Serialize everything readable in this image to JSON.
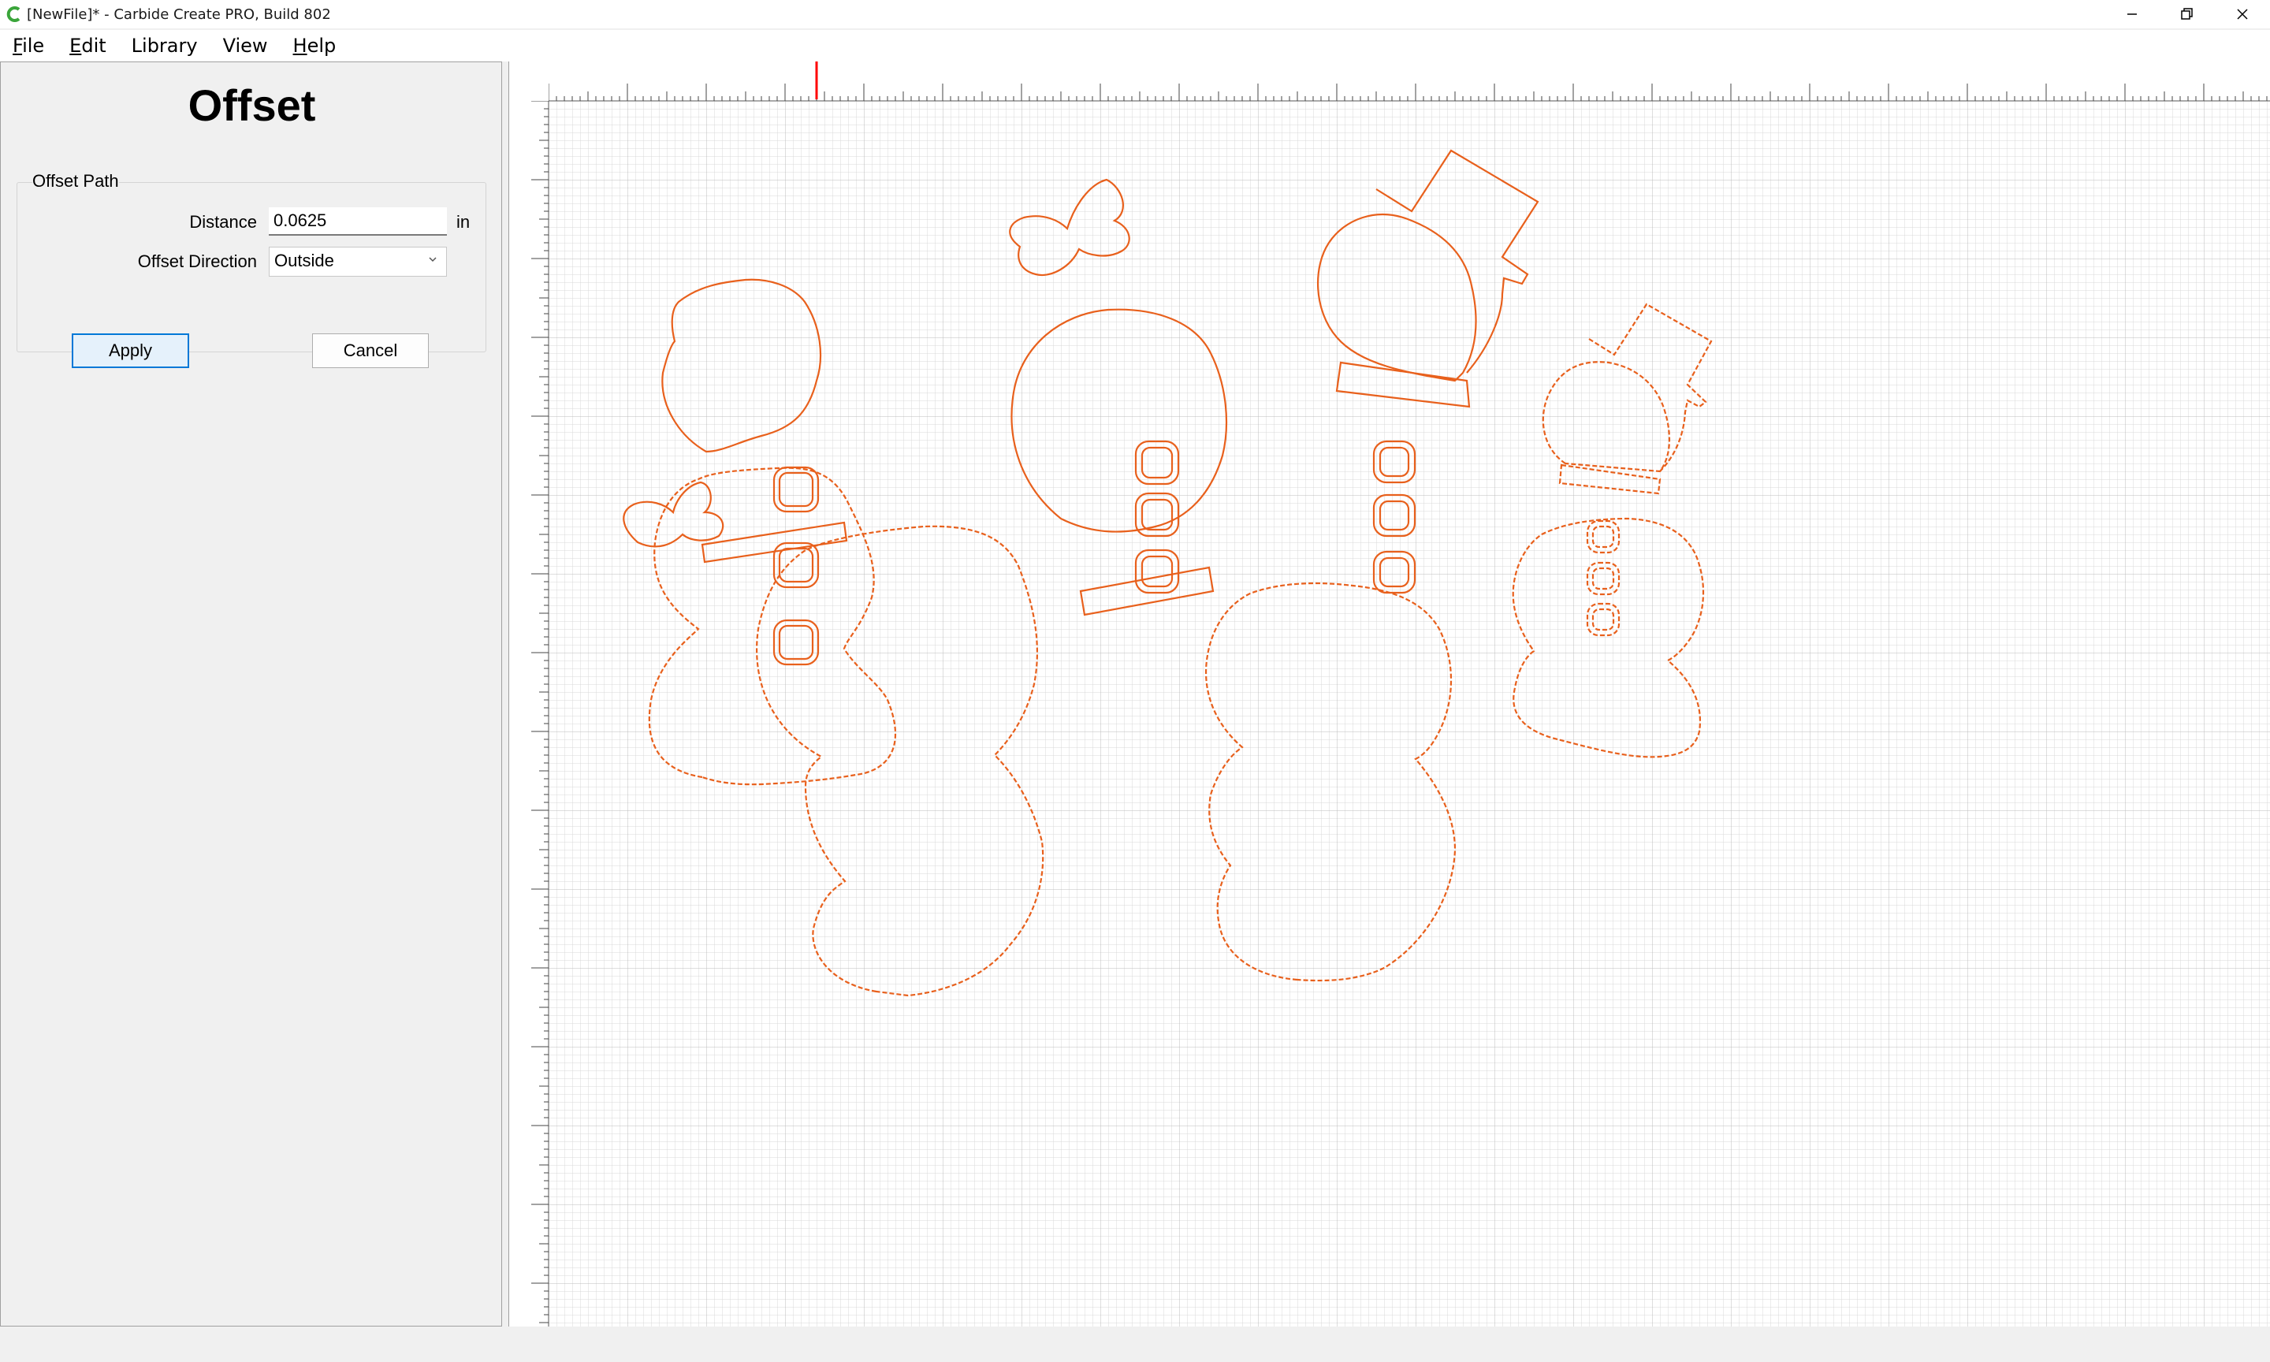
{
  "window": {
    "title": "[NewFile]* - Carbide Create PRO, Build 802",
    "app_icon": "carbide-logo-icon",
    "controls": [
      "minimize-icon",
      "restore-icon",
      "close-icon"
    ]
  },
  "menu": {
    "items": [
      {
        "first": "F",
        "rest": "ile"
      },
      {
        "first": "E",
        "rest": "dit"
      },
      {
        "first": "",
        "rest": "Library"
      },
      {
        "first": "",
        "rest": "View"
      },
      {
        "first": "H",
        "rest": "elp"
      }
    ]
  },
  "panel": {
    "title": "Offset",
    "group_label": "Offset Path",
    "distance_label": "Distance",
    "distance_value": "0.0625",
    "distance_unit": "in",
    "direction_label": "Offset Direction",
    "direction_value": "Outside",
    "apply_label": "Apply",
    "cancel_label": "Cancel"
  },
  "canvas": {
    "grid": true,
    "shape_color": "#e8601c",
    "ruler_marker_color": "#ff0000",
    "shapes": [
      "snowman-small-bow",
      "snowman-large-bow",
      "snowman-large-top-hat",
      "snowman-small-top-hat"
    ]
  }
}
